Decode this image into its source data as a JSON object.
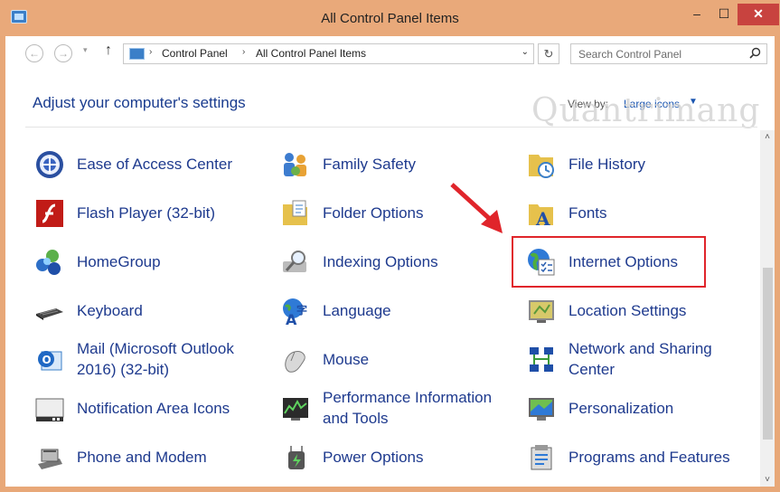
{
  "window": {
    "title": "All Control Panel Items",
    "min_glyph": "–",
    "max_glyph": "☐",
    "close_glyph": "✕"
  },
  "nav": {
    "back_glyph": "←",
    "forward_glyph": "→",
    "recent_glyph": "▾",
    "up_glyph": "↑",
    "breadcrumbs": [
      "Control Panel",
      "All Control Panel Items"
    ],
    "crumb_sep": "›",
    "addr_dropdown_glyph": "⌄",
    "refresh_glyph": "↻",
    "search_placeholder": "Search Control Panel"
  },
  "header": {
    "title": "Adjust your computer's settings",
    "view_by_label": "View by:",
    "view_by_value": "Large icons",
    "view_by_arrow": "▼"
  },
  "watermark": "Quantrimang",
  "items": [
    {
      "label": "Ease of Access Center",
      "icon": "ease-of-access-icon"
    },
    {
      "label": "Family Safety",
      "icon": "family-safety-icon"
    },
    {
      "label": "File History",
      "icon": "file-history-icon"
    },
    {
      "label": "Flash Player (32-bit)",
      "icon": "flash-player-icon"
    },
    {
      "label": "Folder Options",
      "icon": "folder-options-icon"
    },
    {
      "label": "Fonts",
      "icon": "fonts-icon"
    },
    {
      "label": "HomeGroup",
      "icon": "homegroup-icon"
    },
    {
      "label": "Indexing Options",
      "icon": "indexing-options-icon"
    },
    {
      "label": "Internet Options",
      "icon": "internet-options-icon"
    },
    {
      "label": "Keyboard",
      "icon": "keyboard-icon"
    },
    {
      "label": "Language",
      "icon": "language-icon"
    },
    {
      "label": "Location Settings",
      "icon": "location-settings-icon"
    },
    {
      "label_line1": "Mail (Microsoft Outlook",
      "label_line2": "2016) (32-bit)",
      "icon": "mail-icon"
    },
    {
      "label": "Mouse",
      "icon": "mouse-icon"
    },
    {
      "label_line1": "Network and Sharing",
      "label_line2": "Center",
      "icon": "network-sharing-icon"
    },
    {
      "label": "Notification Area Icons",
      "icon": "notification-area-icon"
    },
    {
      "label_line1": "Performance Information",
      "label_line2": "and Tools",
      "icon": "performance-icon"
    },
    {
      "label": "Personalization",
      "icon": "personalization-icon"
    },
    {
      "label": "Phone and Modem",
      "icon": "phone-modem-icon"
    },
    {
      "label": "Power Options",
      "icon": "power-options-icon"
    },
    {
      "label": "Programs and Features",
      "icon": "programs-features-icon"
    }
  ],
  "scrollbar": {
    "up_glyph": "˄",
    "down_glyph": "˅"
  },
  "colors": {
    "titlebar": "#e9a97a",
    "close_button": "#c8433f",
    "link_text": "#1e3a8e",
    "highlight": "#e0252b"
  }
}
